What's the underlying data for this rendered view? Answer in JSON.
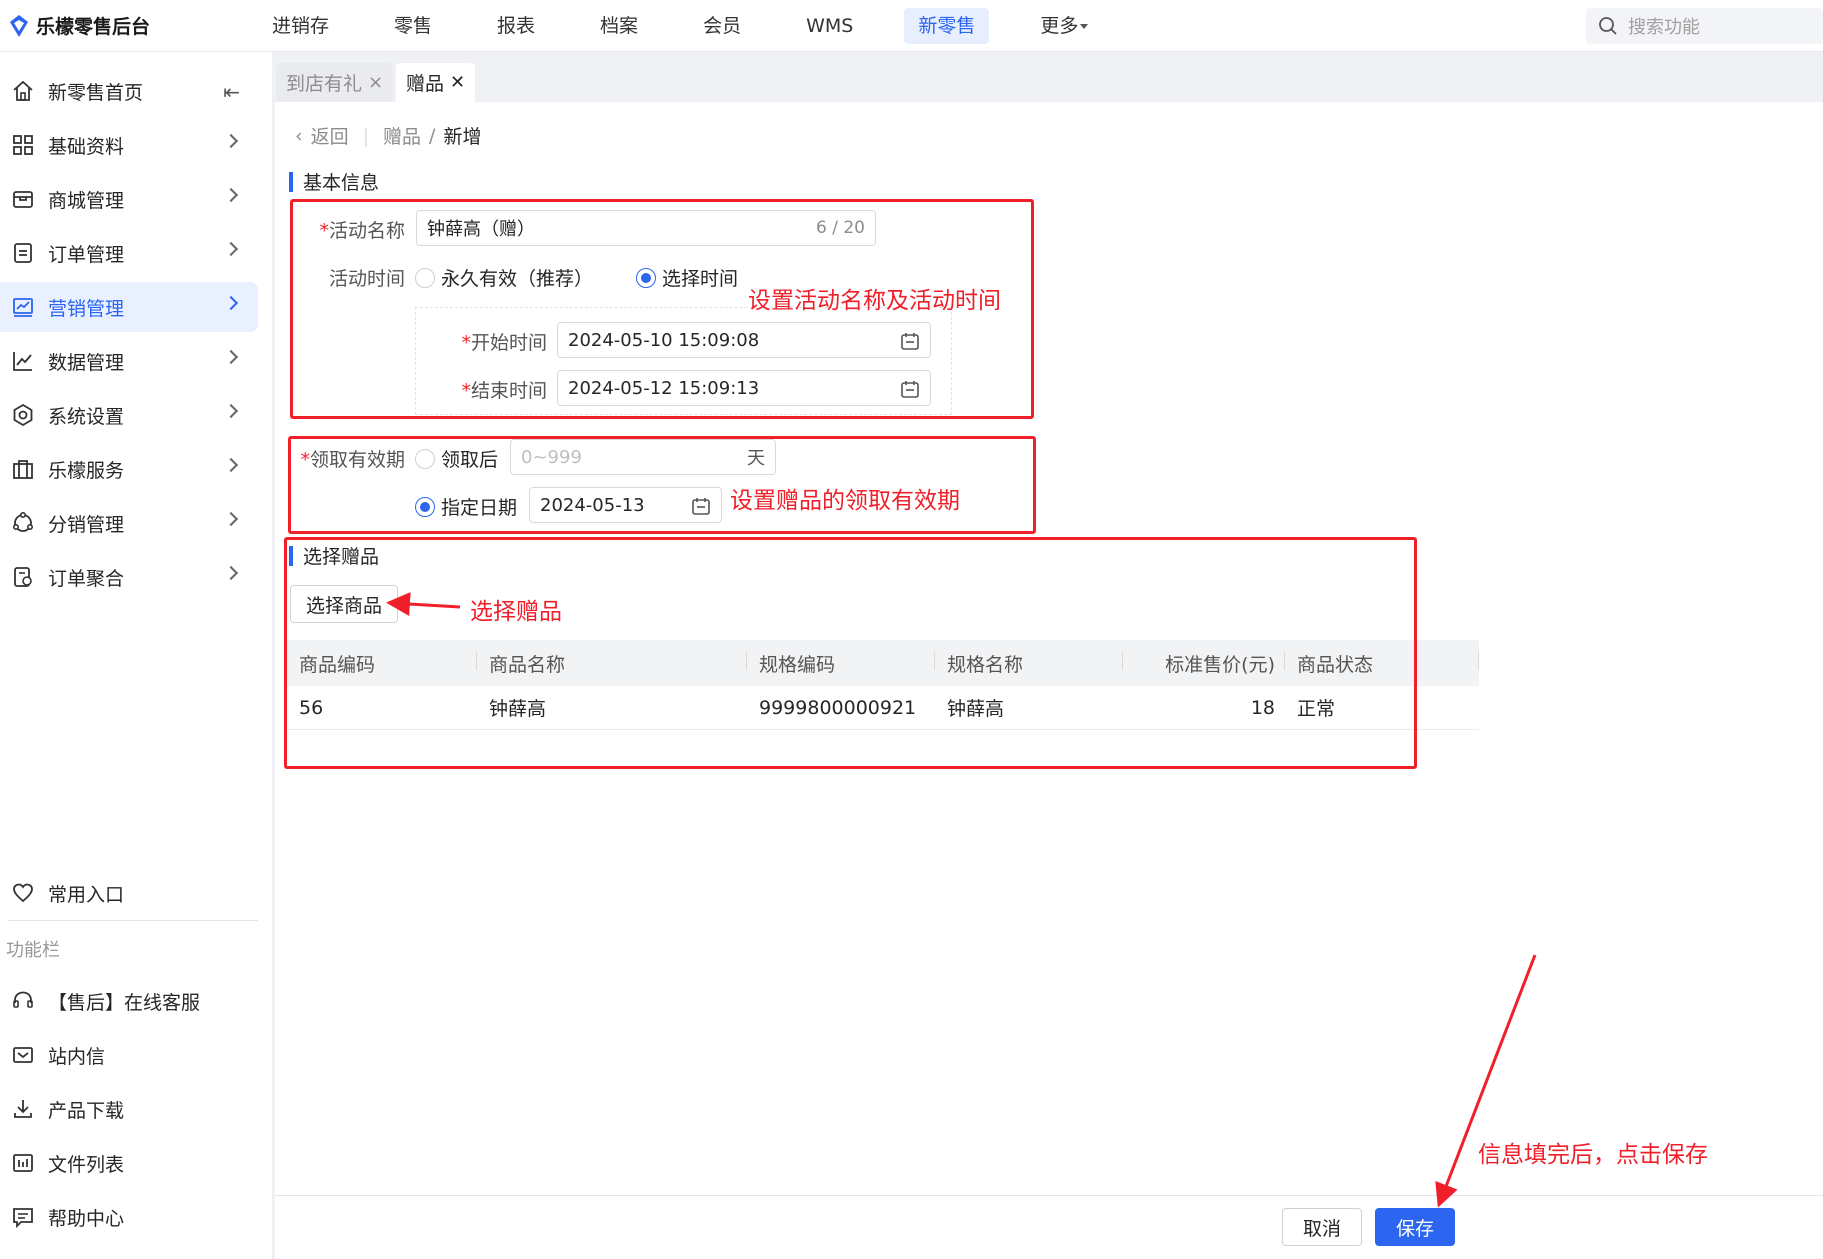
{
  "app": {
    "title": "乐檬零售后台"
  },
  "topnav": {
    "items": [
      "进销存",
      "零售",
      "报表",
      "档案",
      "会员",
      "WMS",
      "新零售",
      "更多"
    ]
  },
  "search": {
    "placeholder": "搜索功能"
  },
  "sidebar": {
    "items": [
      {
        "label": "新零售首页"
      },
      {
        "label": "基础资料"
      },
      {
        "label": "商城管理"
      },
      {
        "label": "订单管理"
      },
      {
        "label": "营销管理"
      },
      {
        "label": "数据管理"
      },
      {
        "label": "系统设置"
      },
      {
        "label": "乐檬服务"
      },
      {
        "label": "分销管理"
      },
      {
        "label": "订单聚合"
      }
    ],
    "common_entry": "常用入口",
    "section_label": "功能栏",
    "func_items": [
      "【售后】在线客服",
      "站内信",
      "产品下载",
      "文件列表",
      "帮助中心"
    ]
  },
  "tabs": [
    {
      "label": "到店有礼"
    },
    {
      "label": "赠品"
    }
  ],
  "breadcrumb": {
    "back": "返回",
    "parent": "赠品",
    "current": "新增"
  },
  "basic_info": {
    "title": "基本信息",
    "name_label": "活动名称",
    "name_value": "钟薛高（赠）",
    "name_count": "6 / 20",
    "time_label": "活动时间",
    "time_opt_forever": "永久有效（推荐）",
    "time_opt_select": "选择时间",
    "start_label": "开始时间",
    "start_value": "2024-05-10 15:09:08",
    "end_label": "结束时间",
    "end_value": "2024-05-12 15:09:13"
  },
  "validity": {
    "label": "领取有效期",
    "after_opt": "领取后",
    "after_placeholder": "0~999",
    "after_unit": "天",
    "date_opt": "指定日期",
    "date_value": "2024-05-13"
  },
  "gift": {
    "title": "选择赠品",
    "select_button": "选择商品",
    "columns": [
      "商品编码",
      "商品名称",
      "规格编码",
      "规格名称",
      "标准售价(元)",
      "商品状态"
    ],
    "rows": [
      [
        "56",
        "钟薛高",
        "9999800000921",
        "钟薛高",
        "18",
        "正常"
      ]
    ]
  },
  "footer": {
    "cancel": "取消",
    "save": "保存"
  },
  "annotations": {
    "a1": "设置活动名称及活动时间",
    "a2": "设置赠品的领取有效期",
    "a3": "选择赠品",
    "a4": "信息填完后，点击保存"
  },
  "colors": {
    "primary": "#2b65f0",
    "annotation": "#f0202a"
  }
}
